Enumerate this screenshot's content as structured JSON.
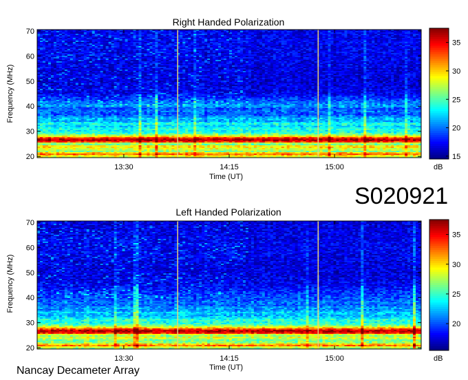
{
  "observation_id": "S020921",
  "footer_text": "Nancay Decameter Array",
  "chart_data": [
    {
      "type": "heatmap",
      "title": "Right Handed Polarization",
      "xlabel": "Time (UT)",
      "ylabel": "Frequency (MHz)",
      "x_ticks": [
        "13:30",
        "14:15",
        "15:00"
      ],
      "x_tick_minutes": [
        810,
        855,
        900
      ],
      "x_range_minutes": [
        773,
        937
      ],
      "y_ticks": [
        20,
        30,
        40,
        50,
        60,
        70
      ],
      "ylim": [
        19.5,
        70.5
      ],
      "colorbar": {
        "label": "dB",
        "ticks": [
          15,
          20,
          25,
          30,
          35
        ],
        "range": [
          14.5,
          37.5
        ]
      },
      "vertical_markers_minutes": [
        833,
        893
      ],
      "intensity_profile": [
        {
          "mhz": 20,
          "db": 28
        },
        {
          "mhz": 21,
          "db": 33
        },
        {
          "mhz": 22,
          "db": 26
        },
        {
          "mhz": 23,
          "db": 28
        },
        {
          "mhz": 24,
          "db": 30
        },
        {
          "mhz": 25,
          "db": 24
        },
        {
          "mhz": 26,
          "db": 36
        },
        {
          "mhz": 27,
          "db": 36
        },
        {
          "mhz": 28,
          "db": 29
        },
        {
          "mhz": 29,
          "db": 25
        },
        {
          "mhz": 30,
          "db": 23
        },
        {
          "mhz": 31,
          "db": 24
        },
        {
          "mhz": 32,
          "db": 22
        },
        {
          "mhz": 33,
          "db": 24
        },
        {
          "mhz": 34,
          "db": 21
        },
        {
          "mhz": 35,
          "db": 22
        },
        {
          "mhz": 36,
          "db": 20
        },
        {
          "mhz": 37,
          "db": 19
        },
        {
          "mhz": 38,
          "db": 20
        },
        {
          "mhz": 39,
          "db": 19
        },
        {
          "mhz": 40,
          "db": 21
        },
        {
          "mhz": 45,
          "db": 17
        },
        {
          "mhz": 50,
          "db": 16.5
        },
        {
          "mhz": 60,
          "db": 17
        },
        {
          "mhz": 70,
          "db": 17
        }
      ]
    },
    {
      "type": "heatmap",
      "title": "Left Handed Polarization",
      "xlabel": "Time (UT)",
      "ylabel": "Frequency (MHz)",
      "x_ticks": [
        "13:30",
        "14:15",
        "15:00"
      ],
      "x_tick_minutes": [
        810,
        855,
        900
      ],
      "x_range_minutes": [
        773,
        937
      ],
      "y_ticks": [
        20,
        30,
        40,
        50,
        60,
        70
      ],
      "ylim": [
        19.5,
        70.5
      ],
      "colorbar": {
        "label": "dB",
        "ticks": [
          20,
          25,
          30,
          35
        ],
        "range": [
          15.5,
          37.5
        ]
      },
      "vertical_markers_minutes": [
        833,
        893
      ],
      "intensity_profile": [
        {
          "mhz": 20,
          "db": 27
        },
        {
          "mhz": 21,
          "db": 33
        },
        {
          "mhz": 22,
          "db": 27
        },
        {
          "mhz": 23,
          "db": 26
        },
        {
          "mhz": 24,
          "db": 29
        },
        {
          "mhz": 25,
          "db": 26
        },
        {
          "mhz": 26,
          "db": 36
        },
        {
          "mhz": 27,
          "db": 36
        },
        {
          "mhz": 28,
          "db": 30
        },
        {
          "mhz": 29,
          "db": 26
        },
        {
          "mhz": 30,
          "db": 24
        },
        {
          "mhz": 31,
          "db": 25
        },
        {
          "mhz": 32,
          "db": 23
        },
        {
          "mhz": 33,
          "db": 22
        },
        {
          "mhz": 34,
          "db": 23
        },
        {
          "mhz": 35,
          "db": 21
        },
        {
          "mhz": 36,
          "db": 22
        },
        {
          "mhz": 37,
          "db": 20
        },
        {
          "mhz": 38,
          "db": 21
        },
        {
          "mhz": 39,
          "db": 20
        },
        {
          "mhz": 40,
          "db": 20
        },
        {
          "mhz": 45,
          "db": 18
        },
        {
          "mhz": 50,
          "db": 17.5
        },
        {
          "mhz": 60,
          "db": 18
        },
        {
          "mhz": 70,
          "db": 17.5
        }
      ]
    }
  ]
}
